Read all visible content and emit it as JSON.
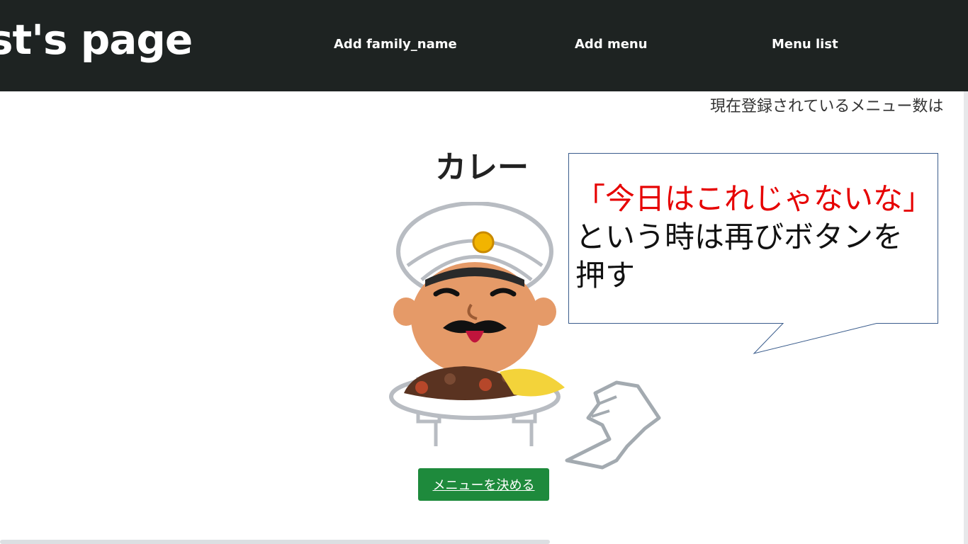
{
  "navbar": {
    "brand": "st's page",
    "links": [
      "Add family_name",
      "Add menu",
      "Menu list"
    ]
  },
  "status": {
    "menu_count_text": "現在登録されているメニュー数は"
  },
  "menu": {
    "title": "カレー",
    "decide_button": "メニューを決める"
  },
  "callout": {
    "red_line": "「今日はこれじゃないな」",
    "black_line": "という時は再びボタンを押す"
  },
  "colors": {
    "navbar_bg": "#1e2322",
    "button_green": "#1e8a3c",
    "callout_red": "#e60000"
  },
  "icons": {
    "illustration": "curry-chef-illustration",
    "pointer": "pointing-hand-icon"
  }
}
